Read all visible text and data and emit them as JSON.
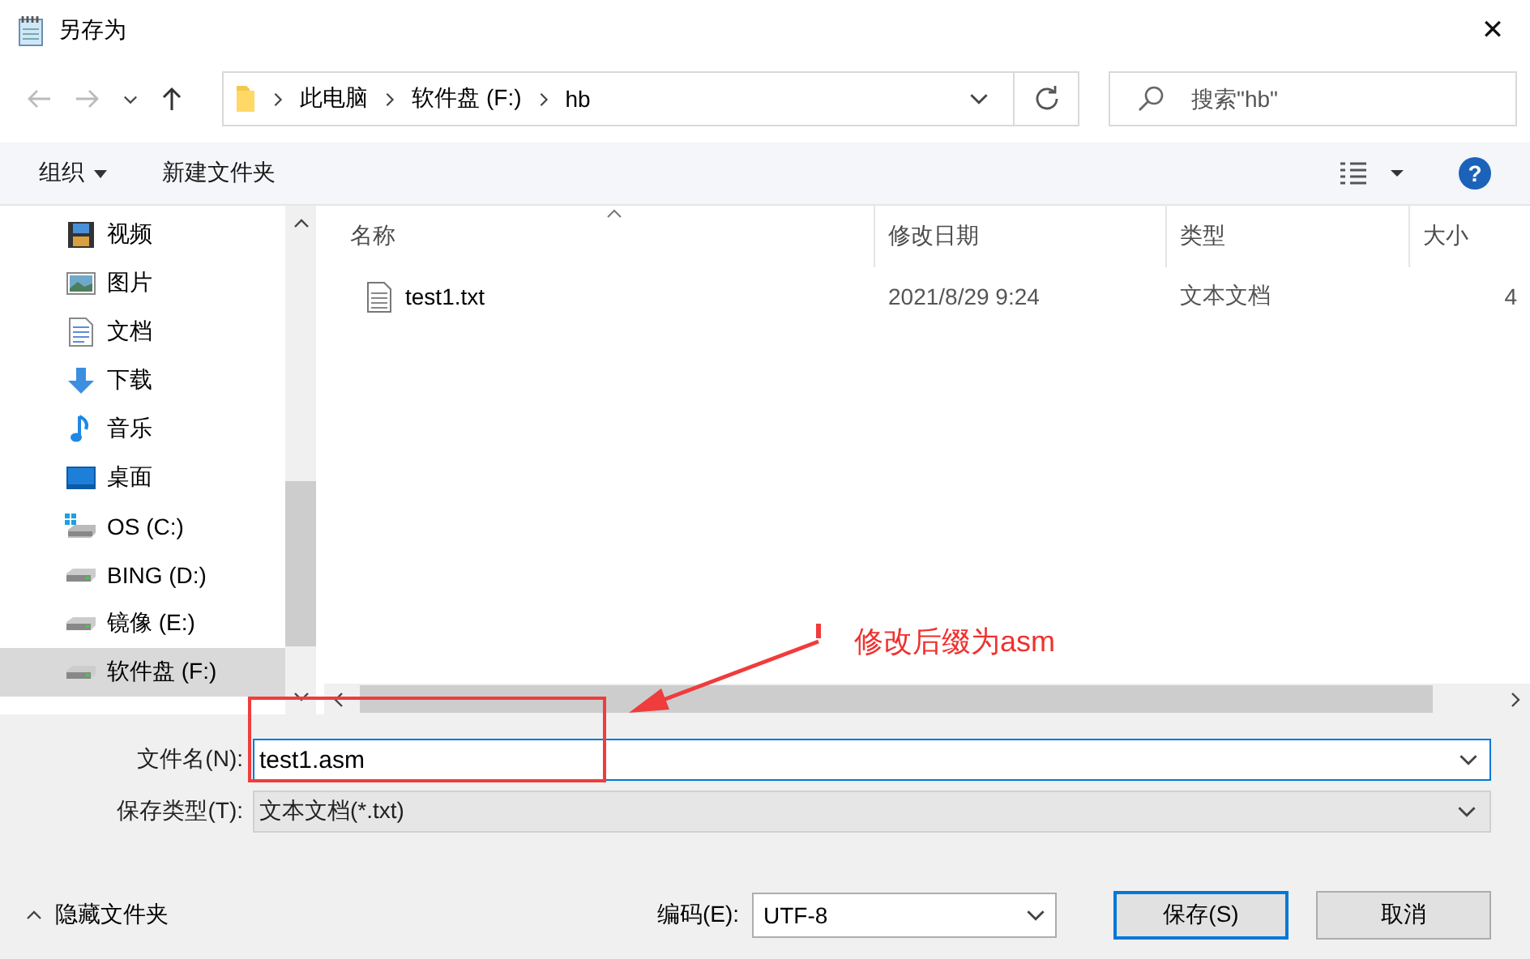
{
  "window": {
    "title": "另存为",
    "close": "✕"
  },
  "address_bar": {
    "path": [
      {
        "label": "此电脑"
      },
      {
        "label": "软件盘 (F:)"
      },
      {
        "label": "hb"
      }
    ]
  },
  "search": {
    "placeholder": "搜索\"hb\""
  },
  "toolbar": {
    "organize": "组织",
    "new_folder": "新建文件夹",
    "help": "?"
  },
  "sidebar": {
    "items": [
      {
        "label": "视频",
        "kind": "video",
        "selected": false
      },
      {
        "label": "图片",
        "kind": "picture",
        "selected": false
      },
      {
        "label": "文档",
        "kind": "document",
        "selected": false
      },
      {
        "label": "下载",
        "kind": "download",
        "selected": false
      },
      {
        "label": "音乐",
        "kind": "music",
        "selected": false
      },
      {
        "label": "桌面",
        "kind": "desktop",
        "selected": false
      },
      {
        "label": "OS (C:)",
        "kind": "system-drive",
        "selected": false
      },
      {
        "label": "BING (D:)",
        "kind": "drive",
        "selected": false
      },
      {
        "label": "镜像 (E:)",
        "kind": "drive",
        "selected": false
      },
      {
        "label": "软件盘 (F:)",
        "kind": "drive",
        "selected": true
      }
    ]
  },
  "table": {
    "columns": [
      "名称",
      "修改日期",
      "类型",
      "大小"
    ],
    "rows": [
      {
        "name": "test1.txt",
        "modified": "2021/8/29 9:24",
        "type": "文本文档",
        "size": "4"
      }
    ]
  },
  "form": {
    "file_name_label": "文件名(N):",
    "file_name": "test1.asm",
    "file_type_label": "保存类型(T):",
    "file_type": "文本文档(*.txt)"
  },
  "footer": {
    "hide_folders": "隐藏文件夹",
    "encoding_label": "编码(E):",
    "encoding": "UTF-8",
    "buttons": [
      "保存(S)",
      "取消"
    ]
  },
  "annotation": {
    "text": "修改后缀为asm"
  }
}
